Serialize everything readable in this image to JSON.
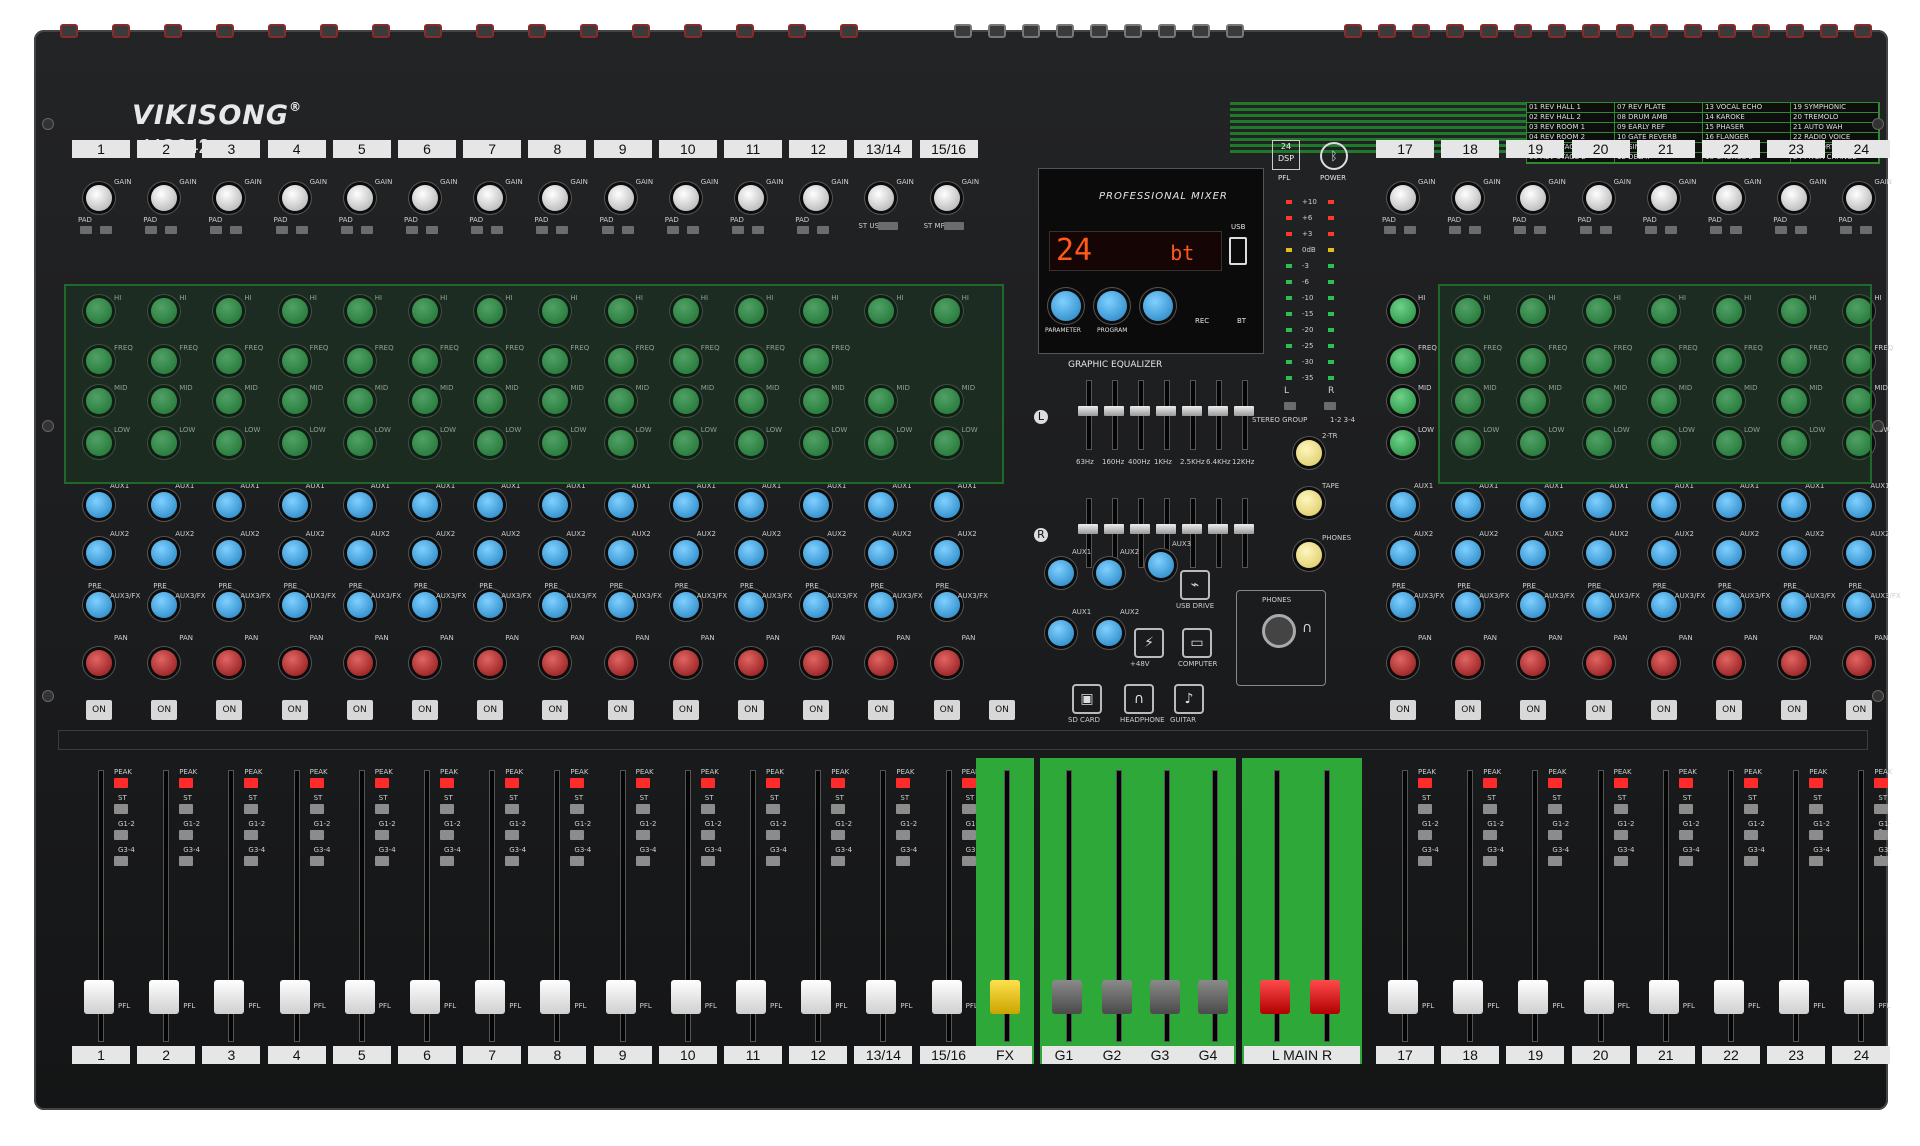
{
  "brand": "VIKISONG",
  "trademark": "®",
  "model": "MQ242",
  "channels_left": [
    "1",
    "2",
    "3",
    "4",
    "5",
    "6",
    "7",
    "8",
    "9",
    "10",
    "11",
    "12",
    "13/14",
    "15/16"
  ],
  "channels_right": [
    "17",
    "18",
    "19",
    "20",
    "21",
    "22",
    "23",
    "24"
  ],
  "bottom_left": [
    "1",
    "2",
    "3",
    "4",
    "5",
    "6",
    "7",
    "8",
    "9",
    "10",
    "11",
    "12",
    "13/14",
    "15/16"
  ],
  "bottom_fx": "FX",
  "bottom_groups": [
    "G1",
    "G2",
    "G3",
    "G4"
  ],
  "bottom_main": "L MAIN R",
  "fx_presets": [
    "01 REV HALL 1",
    "07 REV PLATE",
    "13 VOCAL ECHO",
    "19 SYMPHONIC",
    "02 REV HALL 2",
    "08 DRUM AMB",
    "14 KAROKE",
    "20 TREMOLO",
    "03 REV ROOM 1",
    "09 EARLY REF",
    "15 PHASER",
    "21 AUTO WAH",
    "04 REV ROOM 2",
    "10 GATE REVERB",
    "16 FLANGER",
    "22 RADIO VOICE",
    "05 REV STAGE 1",
    "11 SINGLE DELAY",
    "17 CHORUS 1",
    "23 DISTORTION",
    "06 REV STAGE 2",
    "12 DELAY",
    "18 CHORUS 2",
    "24 PITCH CHANGE"
  ],
  "display": {
    "title": "PROFESSIONAL MIXER",
    "readout_left": "24",
    "readout_right": "bt",
    "usb": "USB",
    "parameter": "PARAMETER",
    "program": "PROGRAM",
    "rec": "REC",
    "bt": "BT"
  },
  "dsp_badge": "24 DSP",
  "power_label": "POWER",
  "pfl_label": "PFL",
  "geq": {
    "title": "GRAPHIC EQUALIZER",
    "bands": [
      "63Hz",
      "160Hz",
      "400Hz",
      "1KHz",
      "2.5KHz",
      "6.4KHz",
      "12KHz"
    ],
    "left": "L",
    "right": "R"
  },
  "master_section": {
    "aux_labels": [
      "AUX1",
      "AUX2",
      "AUX3",
      "AUX1",
      "AUX2"
    ],
    "two_tr": "2-TR",
    "tape": "TAPE",
    "phones": "PHONES",
    "stereo_group": "STEREO GROUP",
    "group_1_2_3_4": "1-2 3-4",
    "plus48v": "+48V",
    "computer": "COMPUTER",
    "usb_drive": "USB DRIVE",
    "sd_card": "SD CARD",
    "headphone": "HEADPHONE",
    "guitar": "GUITAR",
    "phones_out": "PHONES"
  },
  "strip_labels": {
    "gain": "GAIN",
    "hi": "HI",
    "freq": "FREQ",
    "mid": "MID",
    "low": "LOW",
    "aux1": "AUX1",
    "aux2": "AUX2",
    "pre": "PRE",
    "aux3_fx": "AUX3/FX",
    "pan": "PAN",
    "on": "ON",
    "peak": "PEAK",
    "st": "ST",
    "g12": "G1-2",
    "g34": "G3-4",
    "pfl": "PFL",
    "pad": "PAD",
    "usb_st": "ST USB",
    "mp3_st": "ST MP3"
  },
  "meter_scale": [
    "+10",
    "+6",
    "+3",
    "0dB",
    "-3",
    "-6",
    "-10",
    "-15",
    "-20",
    "-25",
    "-30",
    "-35"
  ]
}
